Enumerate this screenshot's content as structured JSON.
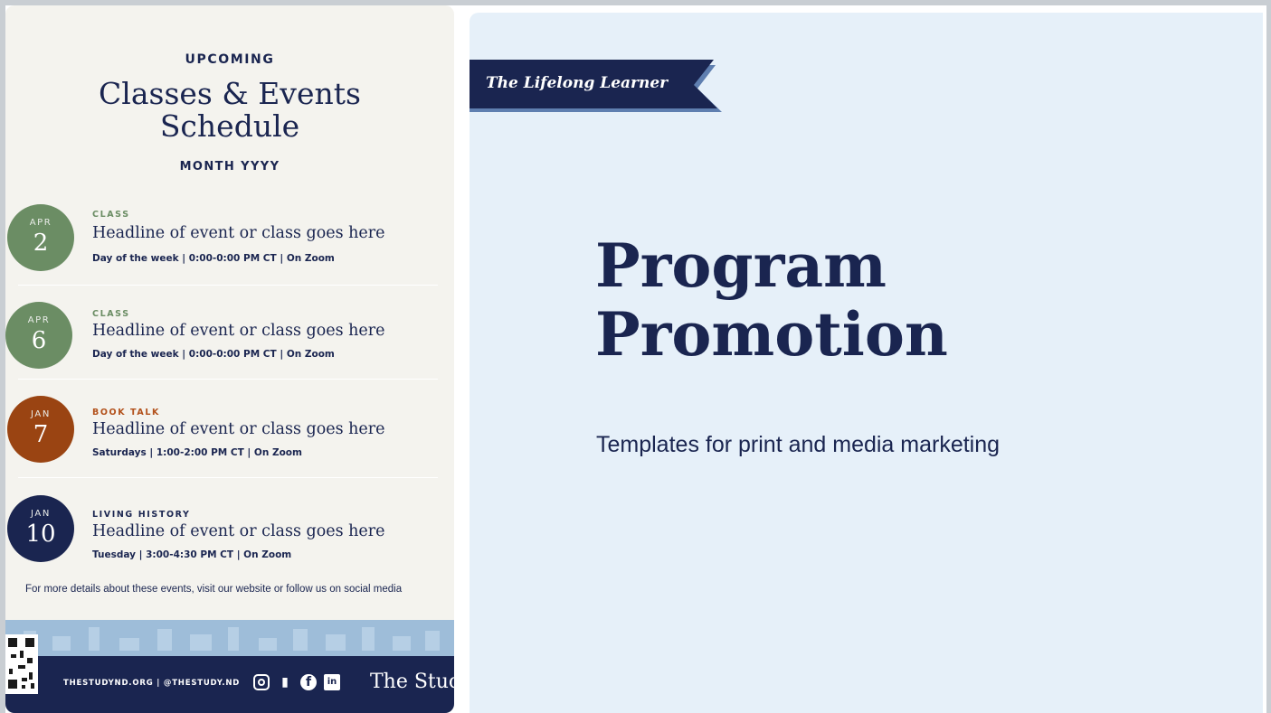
{
  "flyer": {
    "upcoming": "UPCOMING",
    "title_line1": "Classes & Events",
    "title_line2": "Schedule",
    "month": "MONTH YYYY",
    "events": [
      {
        "month": "APR",
        "day": "2",
        "category": "CLASS",
        "headline": "Headline of event or class goes here",
        "time": "Day of the week | 0:00-0:00 PM CT | On Zoom",
        "badge_color": "#6b8d64",
        "category_color": "#6b8d64"
      },
      {
        "month": "APR",
        "day": "6",
        "category": "CLASS",
        "headline": "Headline of event or class goes here",
        "time": "Day of the week | 0:00-0:00 PM CT | On Zoom",
        "badge_color": "#6b8d64",
        "category_color": "#6b8d64"
      },
      {
        "month": "JAN",
        "day": "7",
        "category": "BOOK TALK",
        "headline": "Headline of event or class goes here",
        "time": "Saturdays | 1:00-2:00 PM CT | On Zoom",
        "badge_color": "#9a4412",
        "category_color": "#b2501a"
      },
      {
        "month": "JAN",
        "day": "10",
        "category": "LIVING HISTORY",
        "headline": "Headline of event or class goes here",
        "time": "Tuesday | 3:00-4:30 PM CT | On Zoom",
        "badge_color": "#1a2550",
        "category_color": "#1a2550"
      }
    ],
    "more_details": "For more details about these events, visit our website or follow us on social media",
    "footer_url": "THESTUDYND.ORG | @THESTUDY.ND",
    "footer_brand": "The Stuc",
    "social_icons": [
      "instagram-icon",
      "bookmark-icon",
      "facebook-icon",
      "linkedin-icon"
    ]
  },
  "panel": {
    "logo": "The Lifelong Learner",
    "headline_line1": "Program",
    "headline_line2": "Promotion",
    "subheadline": "Templates for print and media marketing"
  },
  "colors": {
    "navy": "#1a2550",
    "panel_bg": "#e6f0f9",
    "flyer_bg": "#f4f3ee",
    "green": "#6b8d64",
    "rust": "#9a4412"
  }
}
